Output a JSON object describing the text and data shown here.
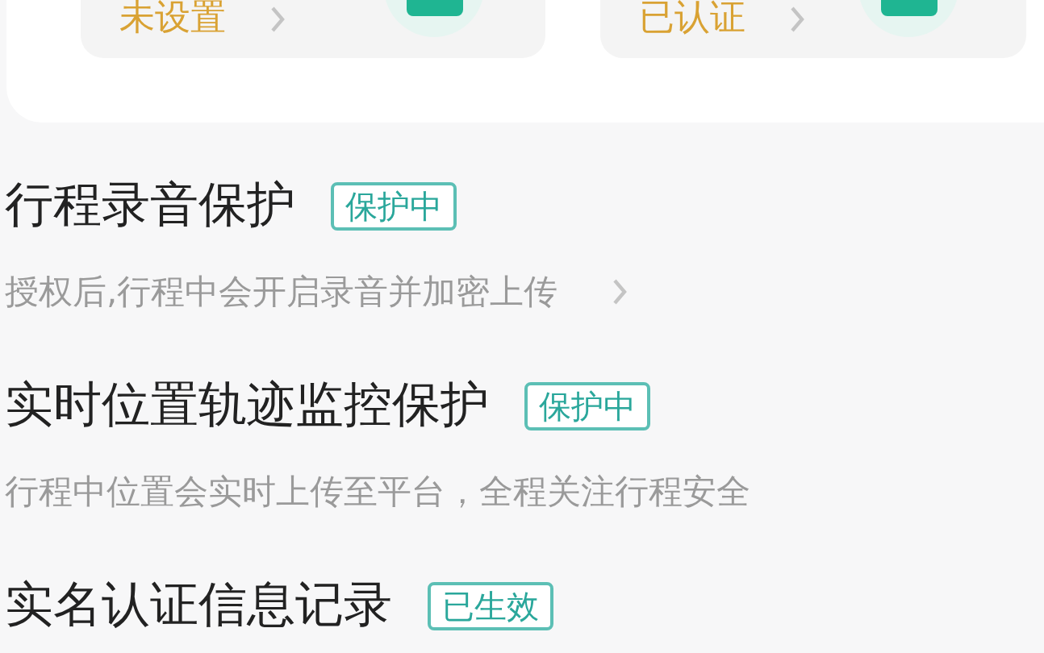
{
  "cards": [
    {
      "status": "未设置"
    },
    {
      "status": "已认证"
    }
  ],
  "sections": [
    {
      "title": "行程录音保护",
      "badge": "保护中",
      "description": "授权后,行程中会开启录音并加密上传",
      "chevron": true
    },
    {
      "title": "实时位置轨迹监控保护",
      "badge": "保护中",
      "description": "行程中位置会实时上传至平台，全程关注行程安全",
      "chevron": false
    },
    {
      "title": "实名认证信息记录",
      "badge": "已生效"
    }
  ]
}
